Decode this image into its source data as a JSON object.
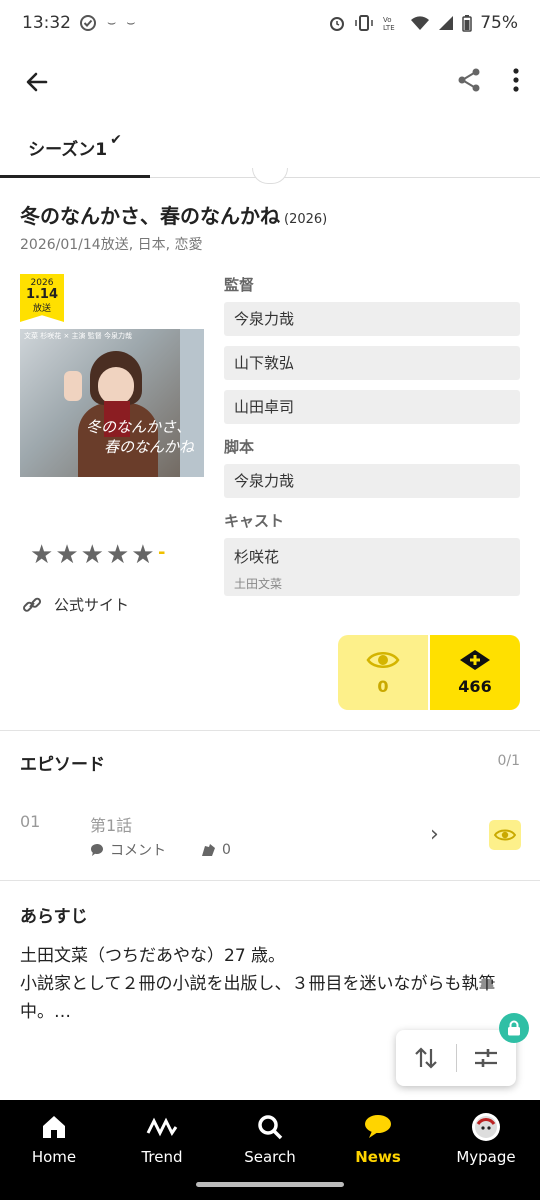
{
  "status_bar": {
    "time": "13:32",
    "battery": "75%"
  },
  "tabs": [
    {
      "label": "シーズン1"
    }
  ],
  "show": {
    "title": "冬のなんかさ、春のなんかね",
    "year": "(2026)",
    "meta": "2026/01/14放送, 日本, 恋愛",
    "badge": {
      "year": "2026",
      "date": "1.14",
      "label": "放送"
    },
    "poster_caption": "文菜 杉咲花 × 主演 監督 今泉力哉",
    "poster_script": [
      "冬のなんかさ、",
      "春のなんかね"
    ],
    "rating_stars": 5,
    "rating_value": "-",
    "official_site": "公式サイト"
  },
  "credits": {
    "director_label": "監督",
    "directors": [
      "今泉力哉",
      "山下敦弘",
      "山田卓司"
    ],
    "writer_label": "脚本",
    "writers": [
      "今泉力哉"
    ],
    "cast_label": "キャスト",
    "cast": [
      {
        "actor": "杉咲花",
        "role": "土田文菜"
      }
    ]
  },
  "counters": {
    "watched": "0",
    "wish": "466"
  },
  "episodes": {
    "heading": "エピソード",
    "count": "0/1",
    "items": [
      {
        "no": "01",
        "title": "第1話",
        "comment_label": "コメント",
        "likes": "0"
      }
    ]
  },
  "synopsis": {
    "heading": "あらすじ",
    "text": "土田文菜（つちだあやな）27 歳。\n小説家として２冊の小説を出版し、３冊目を迷いながらも執筆中。…"
  },
  "bottom_nav": [
    {
      "label": "Home",
      "icon": "home-icon"
    },
    {
      "label": "Trend",
      "icon": "trend-icon"
    },
    {
      "label": "Search",
      "icon": "search-icon"
    },
    {
      "label": "News",
      "icon": "news-icon",
      "active": true
    },
    {
      "label": "Mypage",
      "icon": "avatar-icon"
    }
  ],
  "colors": {
    "accent": "#ffe000",
    "accent_light": "#fdf08a",
    "lock": "#2fbfa5"
  }
}
